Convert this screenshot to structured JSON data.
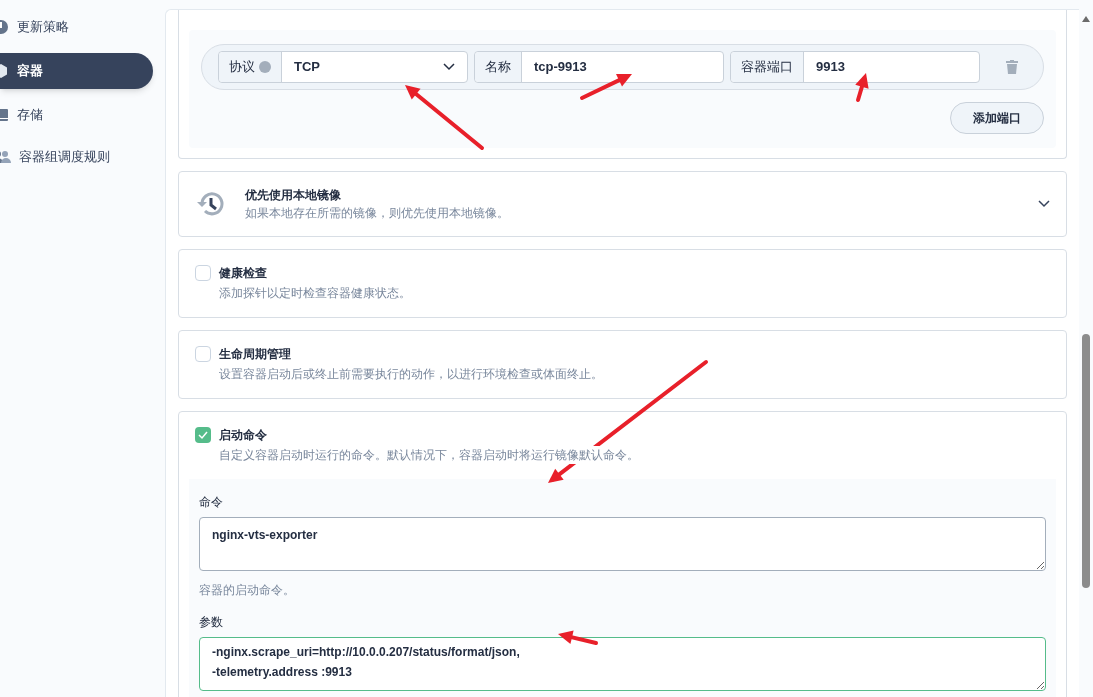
{
  "sidebar": {
    "items": [
      {
        "label": "更新策略",
        "selected": false
      },
      {
        "label": "容器",
        "selected": true
      },
      {
        "label": "存储",
        "selected": false
      },
      {
        "label": "容器组调度规则",
        "selected": false
      }
    ]
  },
  "ports": {
    "rows": [
      {
        "protocol_label": "协议",
        "protocol": "TCP",
        "name_label": "名称",
        "name": "tcp-9913",
        "port_label": "容器端口",
        "port": "9913"
      }
    ],
    "add_button": "添加端口"
  },
  "sections": [
    {
      "kind": "collapsible",
      "title": "优先使用本地镜像",
      "description": "如果本地存在所需的镜像，则优先使用本地镜像。",
      "expanded": false
    },
    {
      "kind": "checkbox",
      "title": "健康检查",
      "description": "添加探针以定时检查容器健康状态。",
      "checked": false
    },
    {
      "kind": "checkbox",
      "title": "生命周期管理",
      "description": "设置容器启动后或终止前需要执行的动作，以进行环境检查或体面终止。",
      "checked": false
    },
    {
      "kind": "checkbox",
      "title": "启动命令",
      "description": "自定义容器启动时运行的命令。默认情况下，容器启动时将运行镜像默认命令。",
      "checked": true
    }
  ],
  "command": {
    "label": "命令",
    "value": "nginx-vts-exporter",
    "hint": "容器的启动命令。"
  },
  "args": {
    "label": "参数",
    "value": "-nginx.scrape_uri=http://10.0.0.207/status/format/json,\n-telemetry.address :9913"
  }
}
